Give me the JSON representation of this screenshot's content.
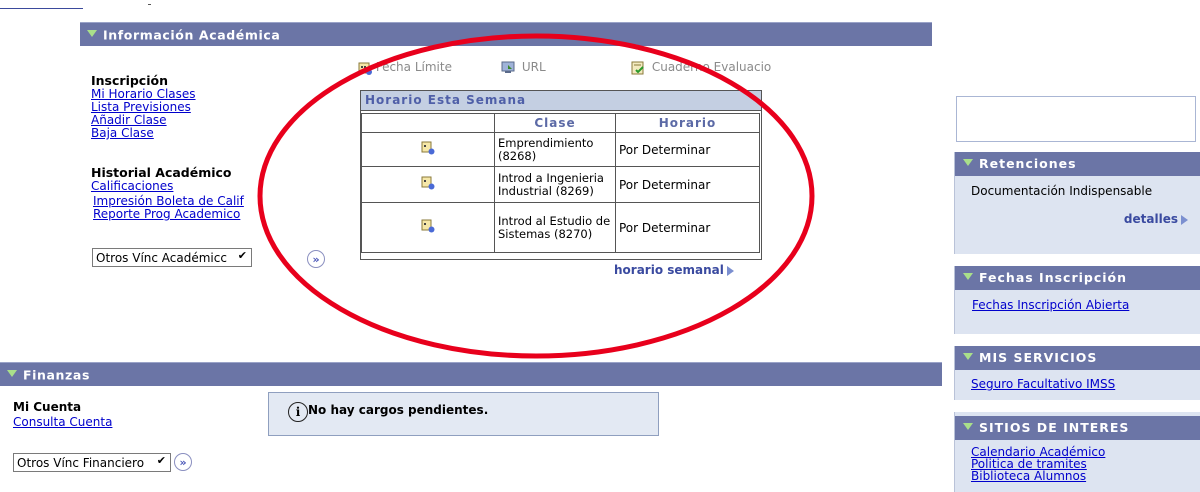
{
  "academic": {
    "header": "Información Académica",
    "inscripcion": {
      "title": "Inscripción",
      "links": [
        "Mi Horario Clases",
        "Lista Previsiones",
        "Añadir Clase",
        "Baja Clase"
      ]
    },
    "historial": {
      "title": "Historial Académico",
      "links": [
        "Calificaciones",
        "Impresión Boleta de Calif",
        "Reporte Prog Academico"
      ]
    },
    "select_value": "Otros Vínc Académicc",
    "toolbar": {
      "fecha": "Fecha Límite",
      "url": "URL",
      "cuaderno": "Cuaderno Evaluacio"
    },
    "schedule": {
      "title": "Horario Esta Semana",
      "col_clase": "Clase",
      "col_horario": "Horario",
      "rows": [
        {
          "clase": "Emprendimiento (8268)",
          "horario": "Por Determinar"
        },
        {
          "clase": "Introd a Ingenieria Industrial (8269)",
          "horario": "Por Determinar"
        },
        {
          "clase": "Introd al Estudio de Sistemas (8270)",
          "horario": "Por Determinar"
        }
      ],
      "weekly_link": "horario semanal"
    }
  },
  "finance": {
    "header": "Finanzas",
    "cuenta_title": "Mi Cuenta",
    "cuenta_link": "Consulta Cuenta",
    "select_value": "Otros Vínc Financiero",
    "message": "No hay cargos pendientes."
  },
  "sidebar": {
    "retenciones": {
      "header": "Retenciones",
      "text": "Documentación Indispensable",
      "link": "detalles"
    },
    "fechas": {
      "header": "Fechas Inscripción",
      "link": "Fechas Inscripción Abierta"
    },
    "servicios": {
      "header": "MIS SERVICIOS",
      "link": "Seguro Facultativo IMSS"
    },
    "sitios": {
      "header": "SITIOS DE INTERES",
      "links": [
        "Calendario Académico",
        "Politica de tramites",
        "Biblioteca Alumnos"
      ]
    }
  },
  "colors": {
    "header_bg": "#6b75a6",
    "annotation": "#e8001c",
    "sidebar_bg": "#dde4f1",
    "link": "#0000cc"
  }
}
